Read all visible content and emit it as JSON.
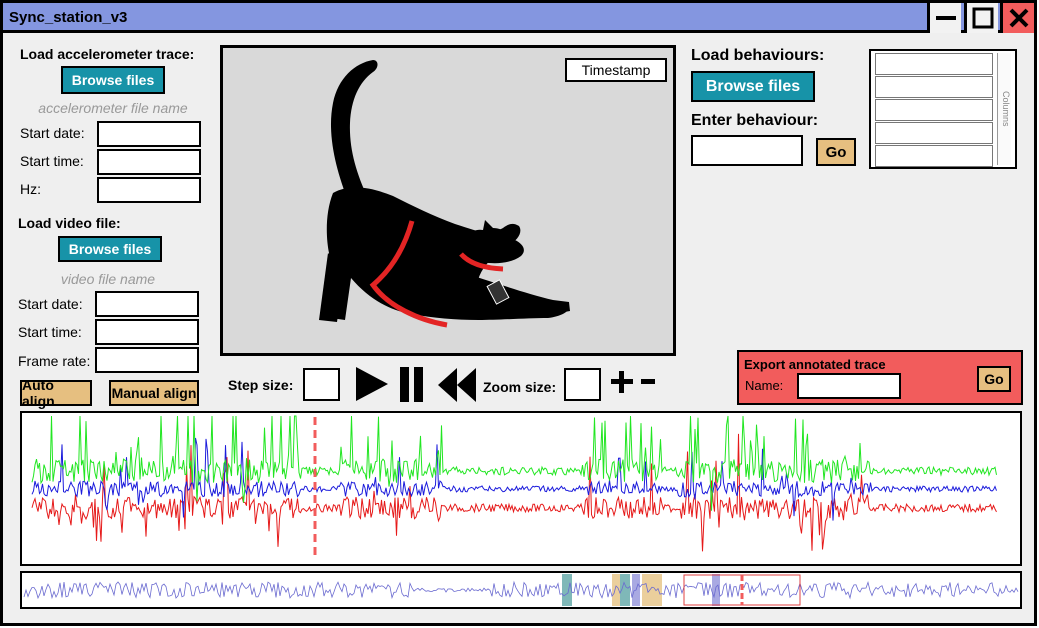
{
  "window": {
    "title": "Sync_station_v3"
  },
  "accelerometer": {
    "heading": "Load accelerometer trace:",
    "browse_label": "Browse files",
    "file_name": "accelerometer file name",
    "start_date_label": "Start date:",
    "start_time_label": "Start time:",
    "hz_label": "Hz:",
    "start_date_value": "",
    "start_time_value": "",
    "hz_value": ""
  },
  "video_file": {
    "heading": "Load video file:",
    "browse_label": "Browse files",
    "file_name": "video file name",
    "start_date_label": "Start date:",
    "start_time_label": "Start time:",
    "frame_rate_label": "Frame rate:",
    "start_date_value": "",
    "start_time_value": "",
    "frame_rate_value": ""
  },
  "align": {
    "auto_label": "Auto align",
    "manual_label": "Manual align"
  },
  "player": {
    "timestamp": "Timestamp",
    "step_size_label": "Step size:",
    "zoom_size_label": "Zoom size:",
    "step_size_value": "",
    "zoom_size_value": ""
  },
  "behaviours": {
    "heading": "Load behaviours:",
    "browse_label": "Browse files",
    "enter_label": "Enter behaviour:",
    "enter_value": "",
    "go_label": "Go",
    "list_rows": [
      "",
      "",
      "",
      "",
      ""
    ],
    "scroll_label": "Columns"
  },
  "export": {
    "heading": "Export annotated trace",
    "name_label": "Name:",
    "name_value": "",
    "go_label": "Go"
  },
  "colors": {
    "titlebar": "#8496e0",
    "button_blue": "#1793a8",
    "button_tan": "#e6bf80",
    "export_red": "#f25c5c",
    "trace_green": "#22e622",
    "trace_blue": "#1c1cdc",
    "trace_red": "#e61a1a",
    "harness_red": "#e32424",
    "overview_line": "#6a6ad0",
    "behaviour_teal": "#7fb8b8",
    "behaviour_tan": "#ebcf9c",
    "behaviour_purple": "#a9a9e2"
  },
  "icons": {
    "minimize": "minimize-icon",
    "maximize": "maximize-icon",
    "close": "close-icon",
    "play": "play-icon",
    "pause": "pause-icon",
    "rewind": "rewind-icon",
    "zoom_in": "plus-icon",
    "zoom_out": "minus-icon"
  }
}
